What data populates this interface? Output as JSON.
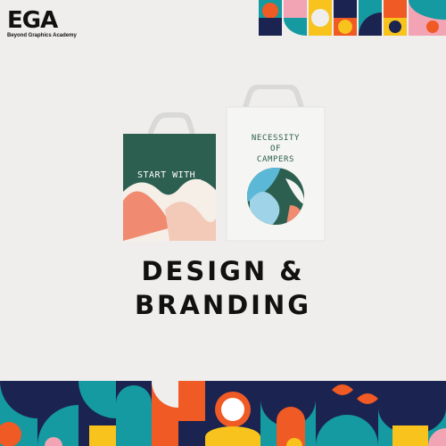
{
  "brand": {
    "logo_mark": "EGA",
    "logo_subtitle": "Beyond Graphics Academy"
  },
  "bag_small": {
    "text": "START WITH_"
  },
  "bag_large": {
    "lines": [
      "NECESSITY",
      "OF",
      "CAMPERS"
    ]
  },
  "headline": {
    "line1": "DESIGN &",
    "line2": "BRANDING"
  },
  "colors": {
    "background": "#efeeec",
    "teal": "#149aa0",
    "navy": "#1b2350",
    "orange": "#f05a24",
    "yellow": "#f7c31c",
    "pink": "#f2a4b4",
    "dark_green": "#2c5e4f",
    "salmon": "#f08a70"
  }
}
